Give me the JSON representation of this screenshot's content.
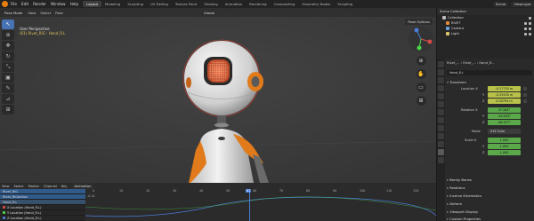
{
  "menu": [
    "File",
    "Edit",
    "Render",
    "Window",
    "Help"
  ],
  "workspaces": [
    "Layout",
    "Modeling",
    "Sculpting",
    "UV Editing",
    "Texture Paint",
    "Shading",
    "Animation",
    "Rendering",
    "Compositing",
    "Geometry Nodes",
    "Scripting"
  ],
  "top_right": {
    "scene": "Scene",
    "view_layer": "ViewLayer"
  },
  "viewport": {
    "mode": "Pose Mode",
    "menus": [
      "View",
      "Select",
      "Pose"
    ],
    "orientation": "Global",
    "pivot": "Pose Options",
    "view_name": "User Perspective",
    "object_info": "(61) Rivet_RIG : Hand_R.L"
  },
  "outliner": {
    "title": "Scene Collection",
    "rows": [
      {
        "label": "Scene Collection",
        "indent": 0,
        "color": "#bbbbbb"
      },
      {
        "label": "Collection",
        "indent": 1,
        "color": "#bbbbbb"
      },
      {
        "label": "RIVET",
        "indent": 2,
        "color": "#e08a3a"
      },
      {
        "label": "Camera",
        "indent": 2,
        "color": "#6a9ed6"
      },
      {
        "label": "Light",
        "indent": 2,
        "color": "#d6c46a"
      }
    ]
  },
  "properties": {
    "breadcrumb": [
      "Rivet_...",
      "Rivet_...",
      "Hand_R..."
    ],
    "bone_name": "Hand_R.L",
    "transform_label": "Transform",
    "location_label": "Location X",
    "location": [
      "-0.17753 m",
      "-0.25435 m",
      "0.05793 m"
    ],
    "rotation_label": "Rotation X",
    "rotation": [
      "37.344°",
      "-53.033°",
      "-64.977°"
    ],
    "mode_label": "Mode",
    "mode_value": "XYZ Euler",
    "scale_label": "Scale X",
    "scale": [
      "1.000",
      "1.000",
      "1.000"
    ],
    "axis_labels": [
      "Y",
      "Z"
    ],
    "sections": [
      "Bendy Bones",
      "Relations",
      "Inverse Kinematics",
      "Deform",
      "Viewport Display",
      "Custom Properties"
    ]
  },
  "timeline": {
    "header": [
      "View",
      "Select",
      "Marker",
      "Channel",
      "Key"
    ],
    "mode": "Animation",
    "rows": [
      {
        "label": "Rivet_RIG",
        "type": "hl"
      },
      {
        "label": "Rivet_RIGAction",
        "type": "hl"
      },
      {
        "label": "Hand_R.L",
        "type": "bone"
      },
      {
        "label": "X Location (Hand_R.L)",
        "type": "ch",
        "color": "#d64a4a"
      },
      {
        "label": "Y Location (Hand_R.L)",
        "type": "ch",
        "color": "#4ad64a"
      },
      {
        "label": "Z Location (Hand_R.L)",
        "type": "ch",
        "color": "#4a7dd6"
      }
    ],
    "frames": [
      "0",
      "10",
      "20",
      "30",
      "40",
      "50",
      "60",
      "70",
      "80",
      "90",
      "100",
      "110",
      "120"
    ],
    "current_frame": "61",
    "value_label": "-0.14"
  },
  "colors": {
    "accent": "#4772b3",
    "orange": "#e87d0d",
    "robot_orange": "#e07a1a",
    "robot_white": "#e8e8e8"
  }
}
